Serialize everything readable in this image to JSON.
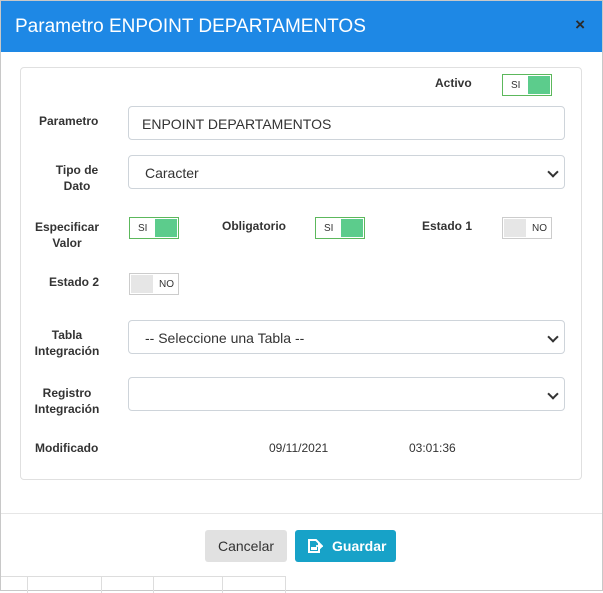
{
  "modal": {
    "title": "Parametro ENPOINT DEPARTAMENTOS",
    "close_icon": "×"
  },
  "form": {
    "activo": {
      "label": "Activo",
      "state": "SI",
      "on": true
    },
    "parametro": {
      "label": "Parametro",
      "value": "ENPOINT DEPARTAMENTOS"
    },
    "tipo_dato": {
      "label_line1": "Tipo de",
      "label_line2": "Dato",
      "selected": "Caracter"
    },
    "especificar_valor": {
      "label_line1": "Especificar",
      "label_line2": "Valor",
      "state": "SI",
      "on": true
    },
    "obligatorio": {
      "label": "Obligatorio",
      "state": "SI",
      "on": true
    },
    "estado1": {
      "label": "Estado 1",
      "state": "NO",
      "on": false
    },
    "estado2": {
      "label": "Estado 2",
      "state": "NO",
      "on": false
    },
    "tabla_integracion": {
      "label_line1": "Tabla",
      "label_line2": "Integración",
      "selected": "-- Seleccione una Tabla --"
    },
    "registro_integracion": {
      "label_line1": "Registro",
      "label_line2": "Integración",
      "selected": ""
    },
    "modificado": {
      "label": "Modificado",
      "date": "09/11/2021",
      "time": "03:01:36"
    }
  },
  "footer": {
    "cancel_label": "Cancelar",
    "save_label": "Guardar",
    "save_icon": "save-icon"
  },
  "colors": {
    "header": "#1e88e5",
    "toggle_on": "#5ccc8c",
    "save_button": "#17a2c8",
    "cancel_button": "#e1e1e1"
  }
}
